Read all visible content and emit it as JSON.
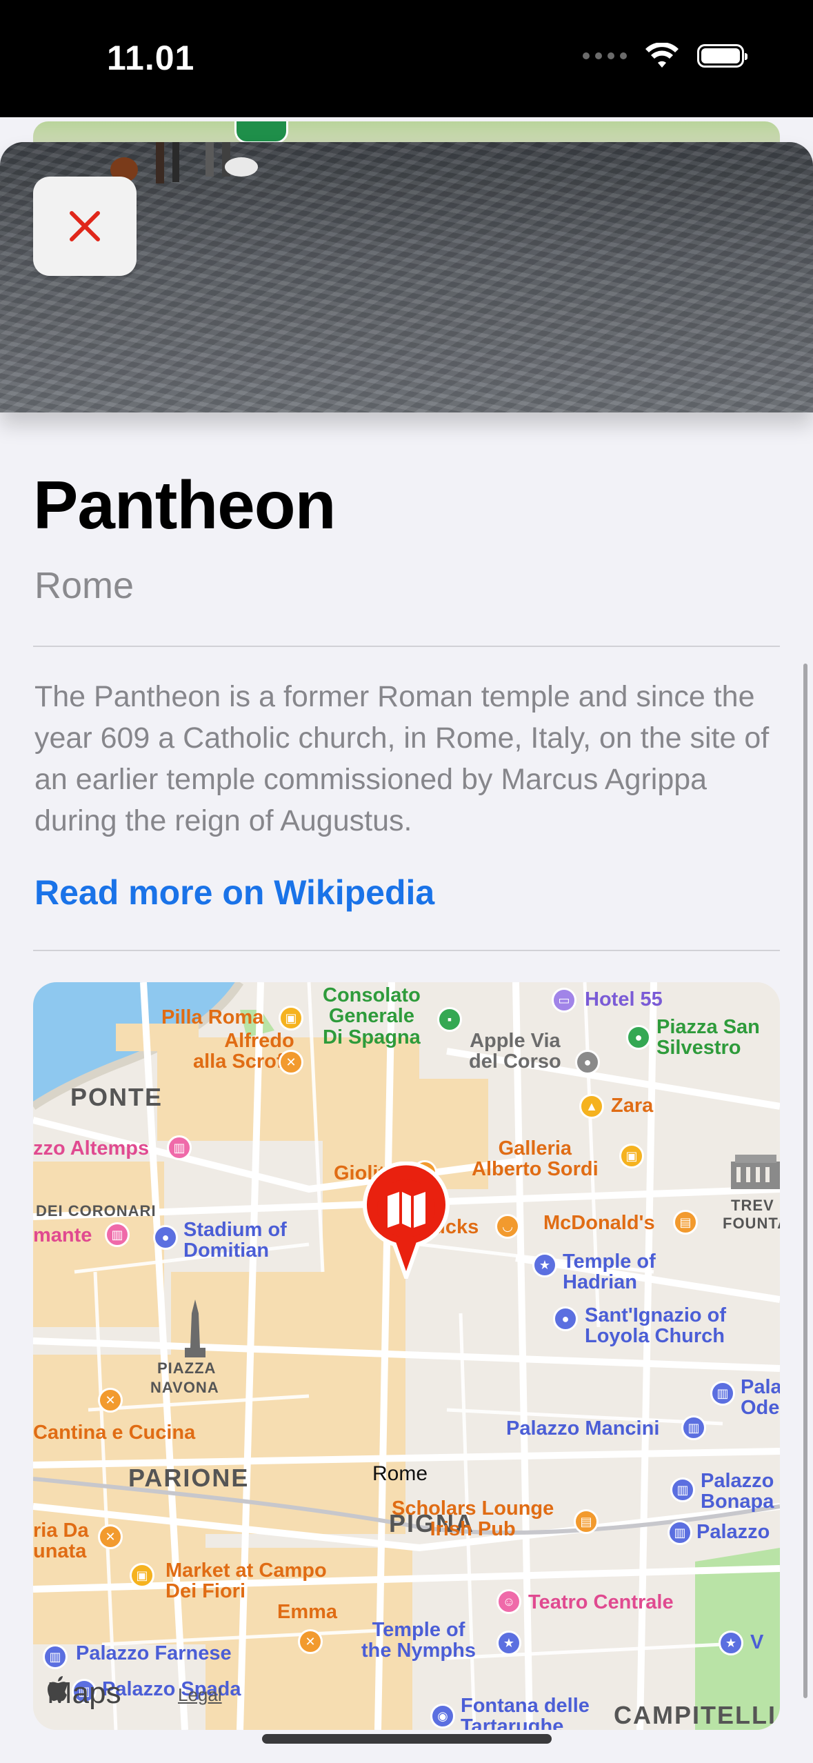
{
  "status": {
    "time": "11.01"
  },
  "hero": {
    "page_count": 3,
    "active_page": 1
  },
  "place": {
    "title": "Pantheon",
    "subtitle": "Rome",
    "description": "The Pantheon is a former Roman temple and since the year 609 a Catholic church, in Rome, Italy, on the site of an earlier temple commissioned by Marcus Agrippa during the reign of Augustus.",
    "link_label": "Read more on Wikipedia"
  },
  "map": {
    "pin_icon": "map-icon",
    "city_label": "Rome",
    "logo_text": "Maps",
    "legal_text": "Legal",
    "districts": [
      "PONTE",
      "PARIONE",
      "PIGNA",
      "CAMPITELLI"
    ],
    "small_labels": [
      "DEI CORONARI",
      "PIAZZA",
      "NAVONA",
      "TREV",
      "FOUNTA"
    ],
    "pois": {
      "consolato": "Consolato\nGenerale\nDi Spagna",
      "hotel55": "Hotel 55",
      "pilla_roma": "Pilla Roma",
      "alfredo": "Alfredo\nalla Scrofa",
      "apple": "Apple Via\ndel Corso",
      "piazza_san_silvestro": "Piazza San\nSilvestro",
      "zara": "Zara",
      "altemps": "zzo Altemps",
      "giolitti": "Giolitti",
      "galleria": "Galleria\nAlberto Sordi",
      "mante": "mante",
      "stadium": "Stadium of\nDomitian",
      "starbucks": "Starbucks",
      "mcdonalds": "McDonald's",
      "temple_hadrian": "Temple of\nHadrian",
      "santignazio": "Sant'Ignazio of\nLoyola Church",
      "pala_ode": "Pala\nOde",
      "cantina": "Cantina e Cucina",
      "palazzo_mancini": "Palazzo Mancini",
      "palazzo_bonapa": "Palazzo\nBonapa",
      "palazzo2": "Palazzo",
      "ria_da": "ria Da\nunata",
      "scholars": "Scholars Lounge\nIrish Pub",
      "market": "Market at Campo\nDei Fiori",
      "teatro": "Teatro Centrale",
      "emma": "Emma",
      "temple_nymphs": "Temple of\nthe Nymphs",
      "farnese": "Palazzo Farnese",
      "spada": "Palazzo Spada",
      "fontana": "Fontana delle\nTartarughe",
      "v": "V"
    }
  }
}
